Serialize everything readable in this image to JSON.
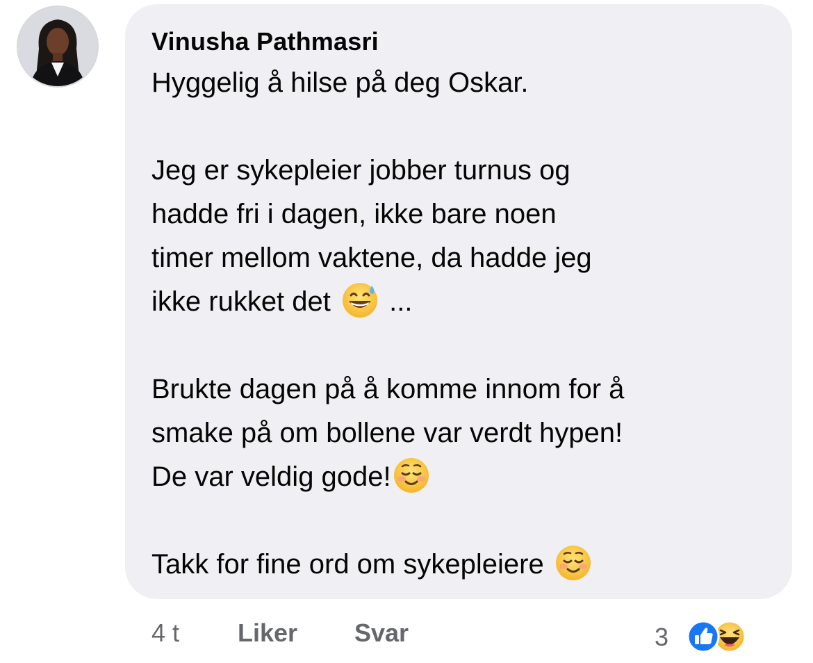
{
  "comment": {
    "author": "Vinusha Pathmasri",
    "paragraphs": {
      "p1": "Hyggelig å hilse på deg Oskar.",
      "p2_line1": "Jeg er sykepleier jobber turnus og",
      "p2_line2": "hadde fri i dagen, ikke bare noen",
      "p2_line3": "timer mellom vaktene, da hadde jeg",
      "p2_line4_before": "ikke rukket det",
      "p2_line4_after": "...",
      "p3_line1": "Brukte dagen på å komme innom for å",
      "p3_line2": "smake på om bollene var verdt hypen!",
      "p3_line3": "De var veldig gode!",
      "p4": "Takk for fine ord om sykepleiere"
    },
    "emojis": {
      "after_rukket": "grinning-sweat-emoji",
      "after_gode": "smiling-blush-emoji",
      "after_sykepleiere": "smiling-blush-emoji"
    }
  },
  "footer": {
    "time": "4 t",
    "like_label": "Liker",
    "reply_label": "Svar",
    "reaction_count": "3",
    "reaction_icons": [
      "like-reaction-icon",
      "haha-reaction-icon"
    ]
  },
  "colors": {
    "bubble_bg": "#f0f0f4",
    "text": "#050505",
    "muted": "#65676b",
    "like_blue": "#1877f2"
  }
}
